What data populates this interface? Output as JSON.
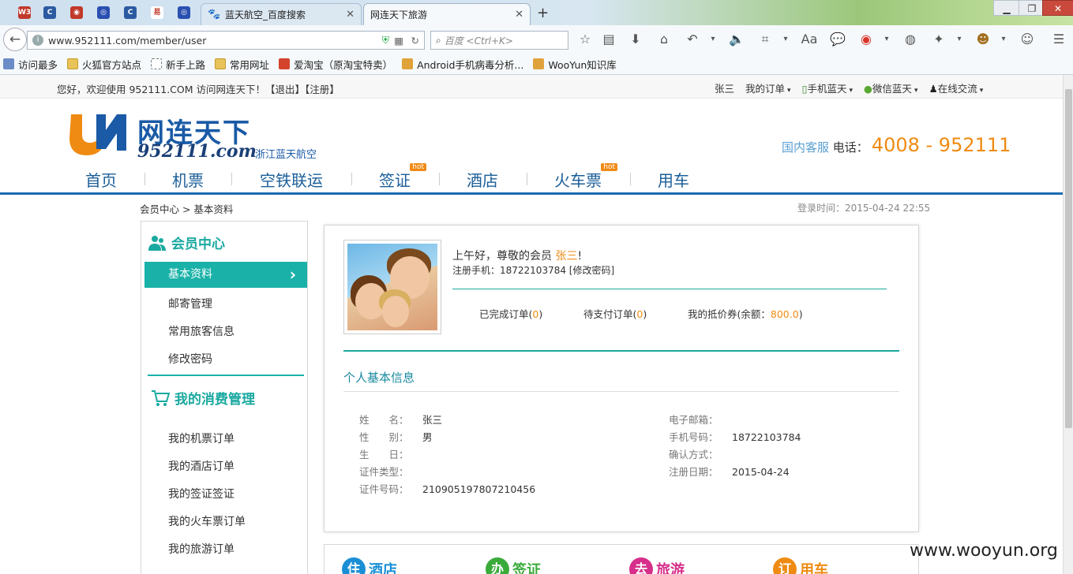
{
  "browser": {
    "tabs": [
      {
        "label": "蓝天航空_百度搜索"
      },
      {
        "label": "网连天下旅游"
      }
    ],
    "url": "www.952111.com/member/user",
    "search_placeholder": "百度 <Ctrl+K>",
    "bookmarks": [
      "访问最多",
      "火狐官方站点",
      "新手上路",
      "常用网址",
      "爱淘宝（原淘宝特卖）",
      "Android手机病毒分析...",
      "WooYun知识库"
    ]
  },
  "topbar": {
    "welcome": "您好，欢迎使用 952111.COM 访问网连天下！【退出】【注册】",
    "user": "张三",
    "orders": "我的订单",
    "mobile": "手机蓝天",
    "wechat": "微信蓝天",
    "online": "在线交流"
  },
  "logo": {
    "brand": "网连天下",
    "number": "952111.com",
    "sub": "浙江蓝天航空"
  },
  "hotline": {
    "label": "国内客服",
    "phone_label": "电话：",
    "phone": "4008 - 952111"
  },
  "nav": [
    "首页",
    "机票",
    "空铁联运",
    "签证",
    "酒店",
    "火车票",
    "用车"
  ],
  "hot_badge": "hot",
  "breadcrumb": "会员中心 > 基本资料",
  "login_time": "登录时间：2015-04-24 22:55",
  "sidebar": {
    "member_center": "会员中心",
    "active_item": "基本资料",
    "items": [
      "邮寄管理",
      "常用旅客信息",
      "修改密码"
    ],
    "consume_title": "我的消费管理",
    "consume_items": [
      "我的机票订单",
      "我的酒店订单",
      "我的签证签证",
      "我的火车票订单",
      "我的旅游订单"
    ]
  },
  "profile": {
    "greeting": "上午好，尊敬的会员 ",
    "name": "张三",
    "greeting_end": "!",
    "reg_phone": "注册手机：18722103784    [修改密码]",
    "completed_label": "已完成订单(",
    "completed_count": "0",
    "pending_label": "待支付订单(",
    "pending_count": "0",
    "voucher_label": "我的抵价券(余额：",
    "voucher_amount": "800.0",
    "close_paren": ")"
  },
  "info": {
    "title": "个人基本信息",
    "left": [
      {
        "label": "姓　　名：",
        "value": "张三"
      },
      {
        "label": "性　　别：",
        "value": "男"
      },
      {
        "label": "生　　日：",
        "value": ""
      },
      {
        "label": "证件类型：",
        "value": ""
      },
      {
        "label": "证件号码：",
        "value": "210905197807210456"
      }
    ],
    "right": [
      {
        "label": "电子邮箱：",
        "value": ""
      },
      {
        "label": "手机号码：",
        "value": "18722103784"
      },
      {
        "label": "确认方式：",
        "value": ""
      },
      {
        "label": "注册日期：",
        "value": "2015-04-24"
      }
    ]
  },
  "promos": [
    {
      "char": "住",
      "label": "酒店",
      "color": "#1a8fd6"
    },
    {
      "char": "办",
      "label": "签证",
      "color": "#3aab3a"
    },
    {
      "char": "去",
      "label": "旅游",
      "color": "#d62e8a"
    },
    {
      "char": "订",
      "label": "用车",
      "color": "#ef8b12"
    }
  ],
  "watermark": "www.wooyun.org"
}
